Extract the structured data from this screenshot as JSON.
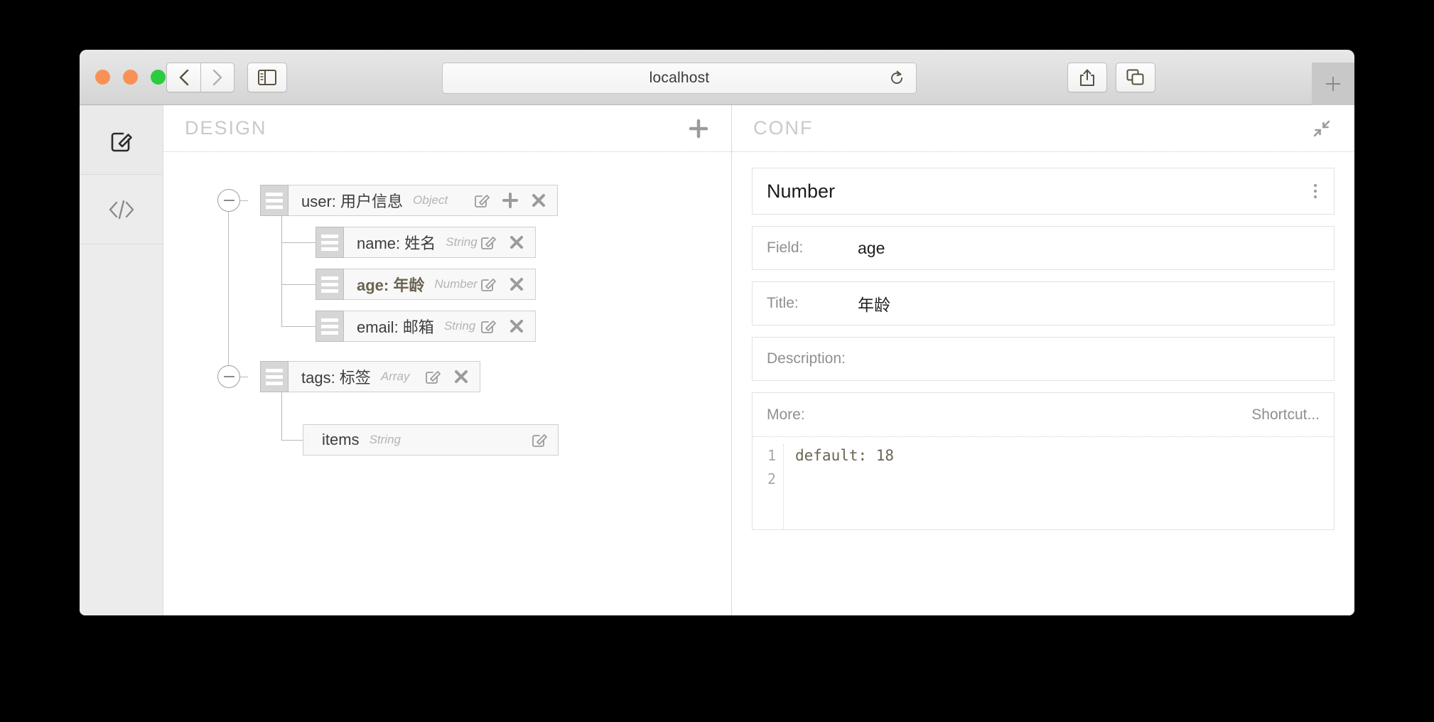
{
  "browser": {
    "address_value": "localhost",
    "buttons": {
      "back": "back-icon",
      "forward": "forward-icon",
      "sidebar": "sidebar-toggle-icon",
      "reload": "reload-icon",
      "share": "share-icon",
      "tabs": "tabs-icon",
      "new_tab": "plus-icon"
    },
    "traffic_lights": [
      "close",
      "minimize",
      "zoom"
    ]
  },
  "rail": {
    "items": [
      {
        "name": "design-editor",
        "icon": "pencil-square-icon",
        "active": true
      },
      {
        "name": "code-view",
        "icon": "code-brackets-icon",
        "active": false
      }
    ]
  },
  "design": {
    "title": "DESIGN",
    "add_label": "+",
    "nodes": [
      {
        "key": "user",
        "title": "用户信息",
        "label": "user: 用户信息",
        "type": "Object",
        "depth": 0,
        "selected": false,
        "collapsible": true,
        "has_handle": true,
        "actions": [
          "edit",
          "add",
          "delete"
        ]
      },
      {
        "key": "name",
        "title": "姓名",
        "label": "name: 姓名",
        "type": "String",
        "depth": 1,
        "selected": false,
        "collapsible": false,
        "has_handle": true,
        "actions": [
          "edit",
          "delete"
        ]
      },
      {
        "key": "age",
        "title": "年龄",
        "label": "age: 年龄",
        "type": "Number",
        "depth": 1,
        "selected": true,
        "collapsible": false,
        "has_handle": true,
        "actions": [
          "edit",
          "delete"
        ]
      },
      {
        "key": "email",
        "title": "邮箱",
        "label": "email: 邮箱",
        "type": "String",
        "depth": 1,
        "selected": false,
        "collapsible": false,
        "has_handle": true,
        "actions": [
          "edit",
          "delete"
        ]
      },
      {
        "key": "tags",
        "title": "标签",
        "label": "tags: 标签",
        "type": "Array",
        "depth": 0,
        "selected": false,
        "collapsible": true,
        "has_handle": true,
        "actions": [
          "edit",
          "delete"
        ]
      },
      {
        "key": "items",
        "title": "",
        "label": "items",
        "type": "String",
        "depth": 1,
        "selected": false,
        "collapsible": false,
        "has_handle": false,
        "actions": [
          "edit"
        ]
      }
    ]
  },
  "conf": {
    "title": "CONF",
    "collapse_icon": "collapse-arrows-icon",
    "type_name": "Number",
    "menu_icon": "kebab-menu-icon",
    "fields": [
      {
        "label": "Field:",
        "value": "age"
      },
      {
        "label": "Title:",
        "value": "年龄"
      },
      {
        "label": "Description:",
        "value": ""
      }
    ],
    "more": {
      "label": "More:",
      "shortcut_label": "Shortcut...",
      "line_numbers": [
        "1",
        "2"
      ],
      "code_lines": [
        "default: 18",
        ""
      ]
    }
  },
  "colors": {
    "selected_node": "#6b6451",
    "panel_title": "#c9c9c9",
    "code_text": "#6b6451",
    "traffic_close": "#f99157",
    "traffic_zoom": "#2dcc3e"
  }
}
